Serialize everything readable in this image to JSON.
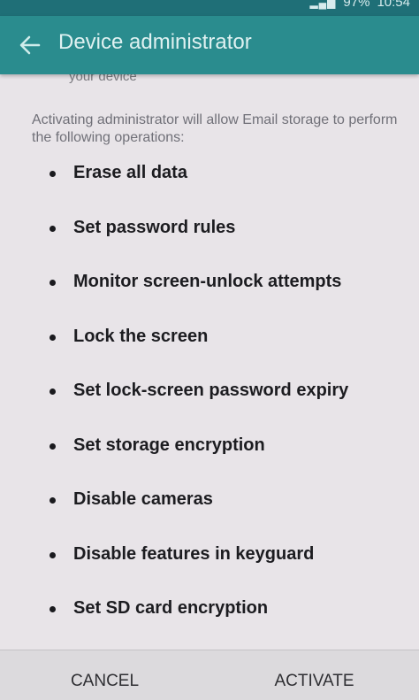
{
  "status_bar": {
    "battery": "97%",
    "time": "10:54"
  },
  "app_bar": {
    "title": "Device administrator"
  },
  "content": {
    "cut_off_text": "your device",
    "intro": "Activating administrator will allow Email storage to perform the following operations:",
    "operations": [
      "Erase all data",
      "Set password rules",
      "Monitor screen-unlock attempts",
      "Lock the screen",
      "Set lock-screen password expiry",
      "Set storage encryption",
      "Disable cameras",
      "Disable features in keyguard",
      "Set SD card encryption"
    ]
  },
  "buttons": {
    "cancel": "CANCEL",
    "activate": "ACTIVATE"
  },
  "colors": {
    "app_bar": "#2a8c8e",
    "status_bar": "#1f6f77",
    "background": "#e8e4e8"
  },
  "icons": {
    "back": "arrow-back-icon"
  }
}
